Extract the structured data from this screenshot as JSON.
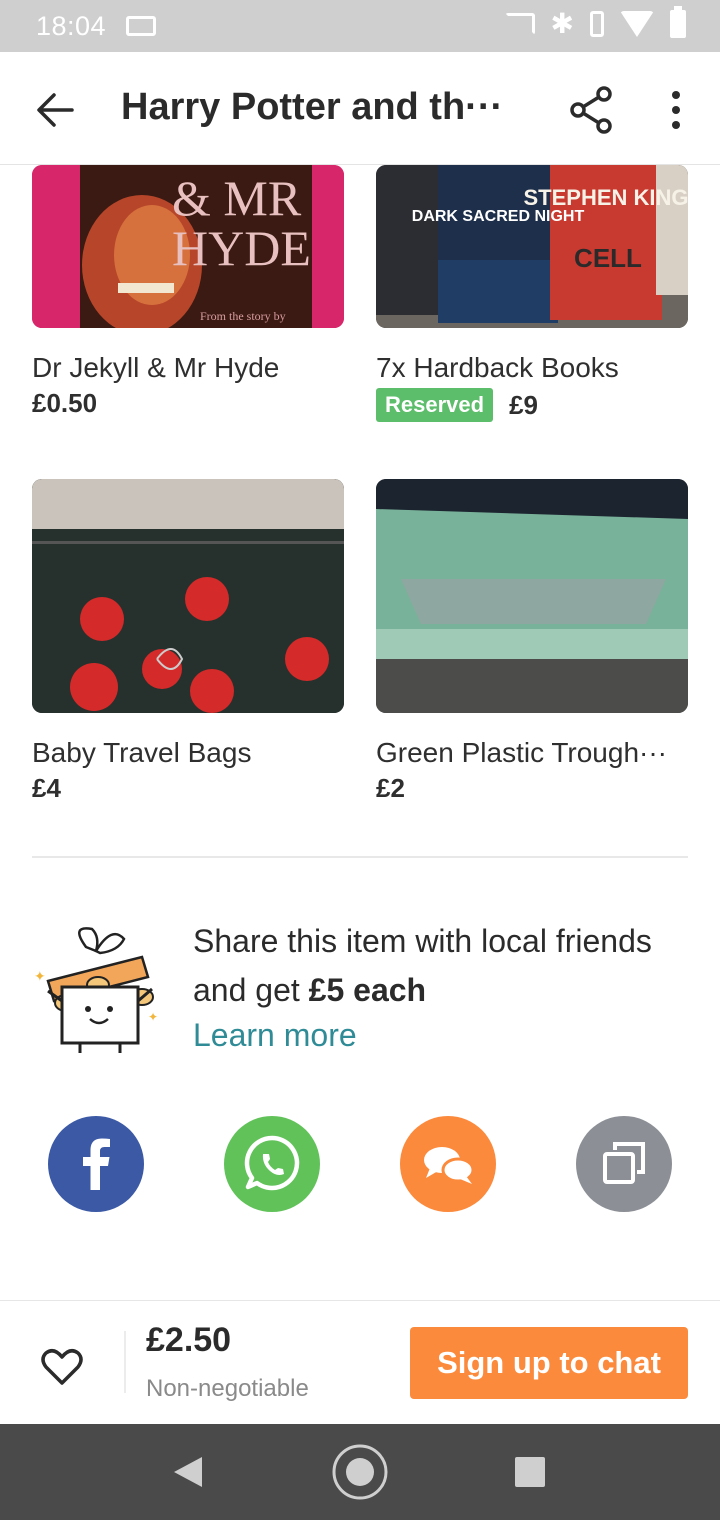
{
  "status_bar": {
    "time": "18:04"
  },
  "header": {
    "title": "Harry Potter and th···"
  },
  "listings": [
    {
      "title": "Dr Jekyll & Mr Hyde",
      "price": "£0.50",
      "image_text": {
        "line1": "& MR",
        "line2": "HYDE",
        "line3": "From the story by"
      }
    },
    {
      "title": "7x Hardback Books",
      "price": "£9",
      "badge": "Reserved",
      "image_text": {
        "book1": "DARK SACRED NIGHT",
        "book2": "STEPHEN KING",
        "book3": "CELL"
      }
    },
    {
      "title": "Baby Travel Bags",
      "price": "£4"
    },
    {
      "title": "Green Plastic Trough···",
      "price": "£2"
    }
  ],
  "promo": {
    "text_part1": "Share this item with local friends and get ",
    "text_bold": "£5 each",
    "link": "Learn more"
  },
  "share_options": [
    {
      "name": "facebook",
      "color": "#3b59a5"
    },
    {
      "name": "whatsapp",
      "color": "#62c25a"
    },
    {
      "name": "message",
      "color": "#fb8a3c"
    },
    {
      "name": "copy-link",
      "color": "#8c9096"
    }
  ],
  "bottom_bar": {
    "price": "£2.50",
    "negotiable": "Non-negotiable",
    "cta": "Sign up to chat"
  },
  "colors": {
    "accent": "#fb8a3c",
    "reserved": "#5cbd6a",
    "link": "#2f8b96"
  }
}
